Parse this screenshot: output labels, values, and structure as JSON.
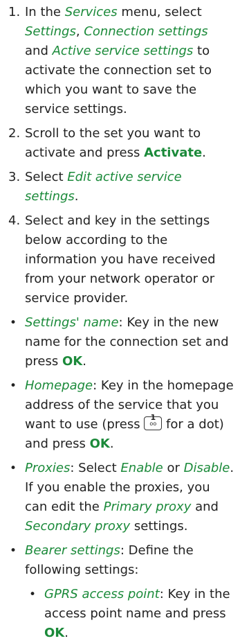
{
  "steps": [
    {
      "num": "1.",
      "t1": "In the ",
      "services": "Services",
      "t2": " menu, select ",
      "settings": "Settings",
      "t3": ", ",
      "connection_settings": "Connection settings",
      "t4": " and ",
      "active_service_settings": "Active service settings",
      "t5": " to activate the connection set to which you want to save the service settings."
    },
    {
      "num": "2.",
      "t1": "Scroll to the set you want to activate and press ",
      "activate": "Activate",
      "t2": "."
    },
    {
      "num": "3.",
      "t1": "Select ",
      "edit_active": "Edit active service settings",
      "t2": "."
    },
    {
      "num": "4.",
      "t1": "Select and key in the settings below according to the information you have received from your network operator or service provider."
    }
  ],
  "bullets": {
    "symbol": "•",
    "settings_name": {
      "label": "Settings' name",
      "t1": ": Key in the new name for the connection set and press ",
      "ok": "OK",
      "t2": "."
    },
    "homepage": {
      "label": "Homepage",
      "t1": ": Key in the homepage address of the service that you want to use (press ",
      "key_top": "1",
      "key_bottom": "oo",
      "t2": " for a dot) and press ",
      "ok": "OK",
      "t3": "."
    },
    "proxies": {
      "label": "Proxies",
      "t1": ": Select ",
      "enable": "Enable",
      "t2": " or ",
      "disable": "Disable",
      "t3": ". If you enable the proxies, you can edit the ",
      "primary_proxy": "Primary proxy",
      "t4": " and ",
      "secondary_proxy": "Secondary proxy",
      "t5": " settings."
    },
    "bearer": {
      "label": "Bearer settings",
      "t1": ": Define the following settings:"
    },
    "gprs": {
      "label": "GPRS access point",
      "t1": ": Key in the access point name and press ",
      "ok": "OK",
      "t2": "."
    }
  },
  "colors": {
    "accent": "#1b8a3a",
    "text": "#222222"
  }
}
